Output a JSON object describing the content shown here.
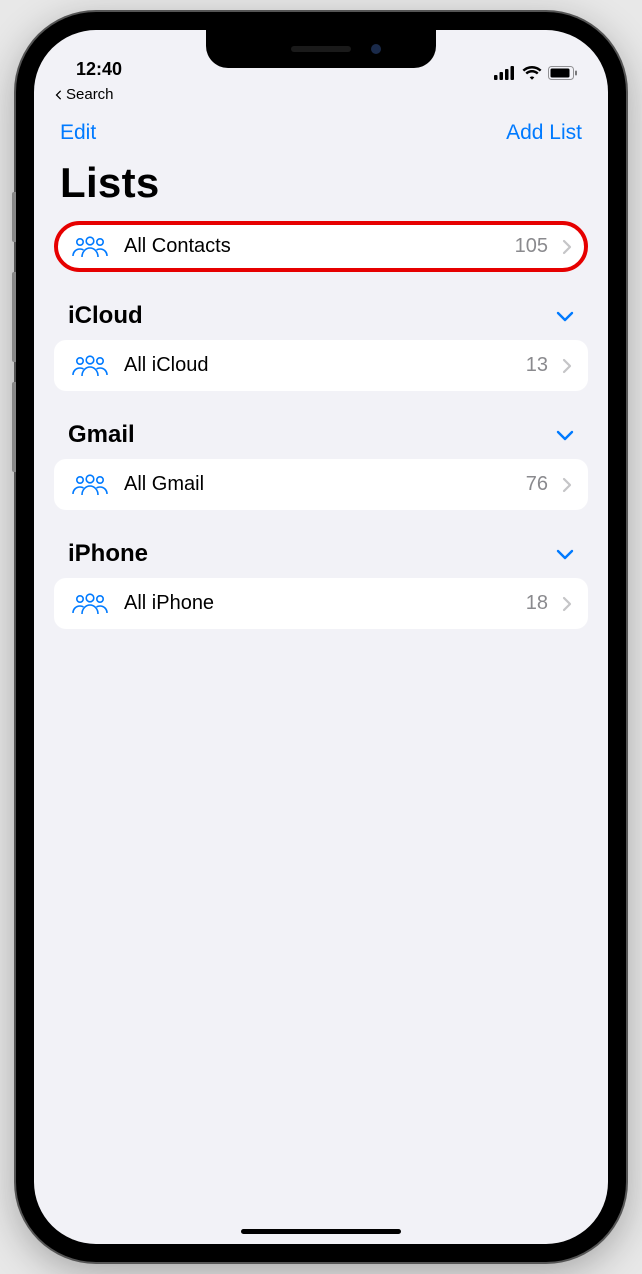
{
  "status": {
    "time": "12:40",
    "breadcrumb": "Search"
  },
  "nav": {
    "edit": "Edit",
    "add_list": "Add List"
  },
  "title": "Lists",
  "all_contacts": {
    "label": "All Contacts",
    "count": "105"
  },
  "sections": [
    {
      "title": "iCloud",
      "items": [
        {
          "label": "All iCloud",
          "count": "13"
        }
      ]
    },
    {
      "title": "Gmail",
      "items": [
        {
          "label": "All Gmail",
          "count": "76"
        }
      ]
    },
    {
      "title": "iPhone",
      "items": [
        {
          "label": "All iPhone",
          "count": "18"
        }
      ]
    }
  ]
}
